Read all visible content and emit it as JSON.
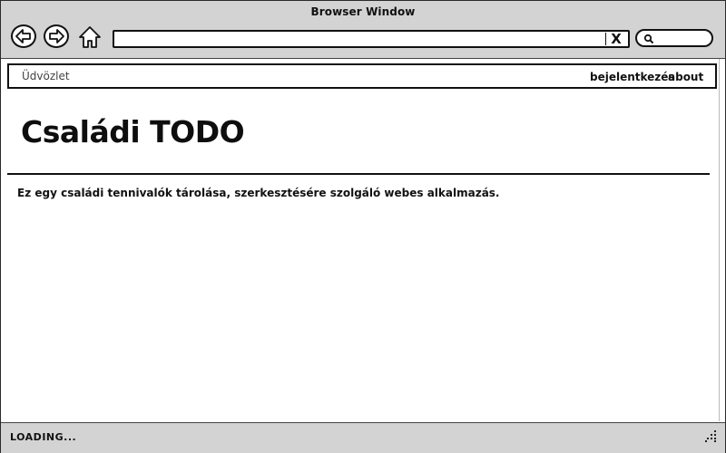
{
  "window": {
    "title": "Browser Window"
  },
  "toolbar": {
    "back_icon": "back-arrow-icon",
    "forward_icon": "forward-arrow-icon",
    "home_icon": "home-icon",
    "url_value": "",
    "clear_label": "X",
    "search_icon": "search-icon",
    "search_value": ""
  },
  "navbar": {
    "greeting": "Üdvözlet",
    "links": [
      {
        "label": "bejelentkezés"
      },
      {
        "label": "about"
      }
    ]
  },
  "main": {
    "title": "Családi TODO",
    "description": "Ez egy családi tennivalók tárolása, szerkesztésére szolgáló webes alkalmazás."
  },
  "status": {
    "text": "LOADING..."
  },
  "colors": {
    "chrome_bg": "#d3d3d3",
    "border": "#111111",
    "page_bg": "#ffffff"
  }
}
